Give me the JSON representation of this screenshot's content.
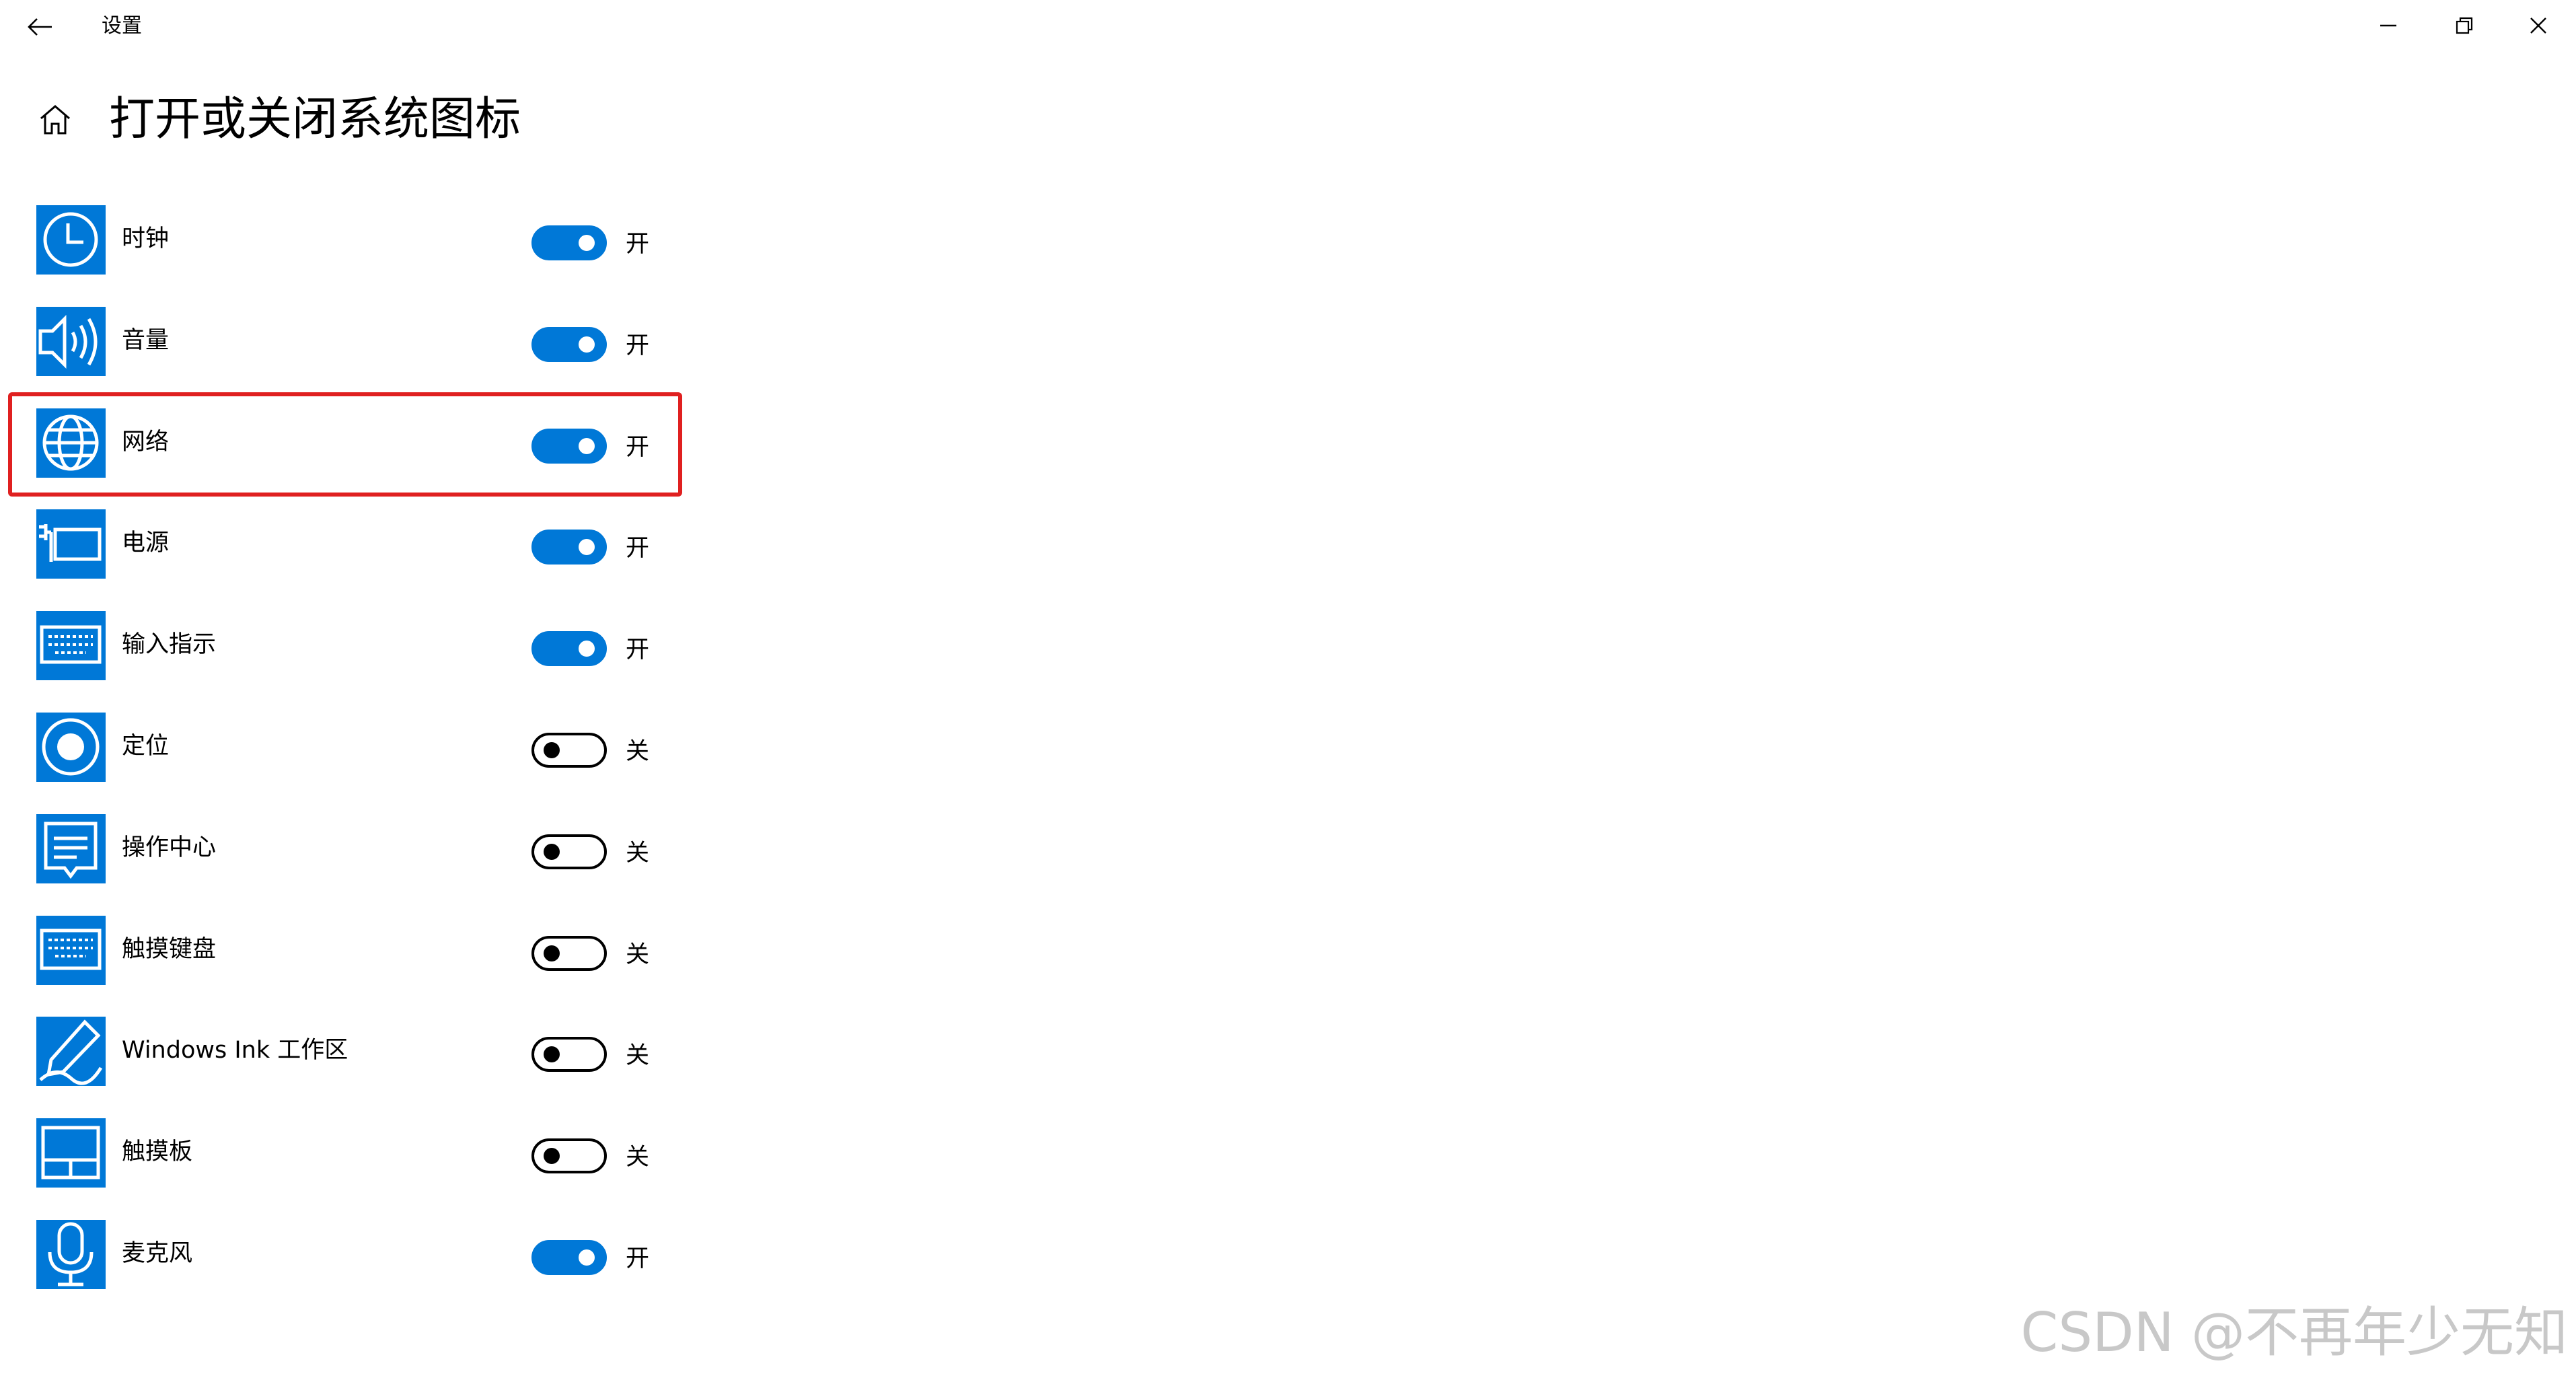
{
  "titlebar": {
    "app_title": "设置",
    "back_icon": "arrow-left-icon",
    "minimize_icon": "minimize-icon",
    "restore_icon": "restore-icon",
    "close_icon": "close-icon"
  },
  "header": {
    "home_icon": "home-icon",
    "title": "打开或关闭系统图标"
  },
  "colors": {
    "accent": "#0078d7",
    "toggle_off_border": "#000000",
    "highlight": "#e02020",
    "watermark": "#c8c8c8"
  },
  "items": [
    {
      "label": "时钟",
      "icon": "clock-icon",
      "on": true,
      "state": "开"
    },
    {
      "label": "音量",
      "icon": "volume-icon",
      "on": true,
      "state": "开"
    },
    {
      "label": "网络",
      "icon": "network-globe-icon",
      "on": true,
      "state": "开",
      "highlighted": true
    },
    {
      "label": "电源",
      "icon": "power-battery-icon",
      "on": true,
      "state": "开"
    },
    {
      "label": "输入指示",
      "icon": "input-keyboard-icon",
      "on": true,
      "state": "开"
    },
    {
      "label": "定位",
      "icon": "location-icon",
      "on": false,
      "state": "关"
    },
    {
      "label": "操作中心",
      "icon": "action-center-icon",
      "on": false,
      "state": "关"
    },
    {
      "label": "触摸键盘",
      "icon": "touch-keyboard-icon",
      "on": false,
      "state": "关"
    },
    {
      "label": "Windows Ink 工作区",
      "icon": "windows-ink-icon",
      "on": false,
      "state": "关"
    },
    {
      "label": "触摸板",
      "icon": "touchpad-icon",
      "on": false,
      "state": "关"
    },
    {
      "label": "麦克风",
      "icon": "microphone-icon",
      "on": true,
      "state": "开"
    }
  ],
  "watermark": "CSDN @不再年少无知"
}
